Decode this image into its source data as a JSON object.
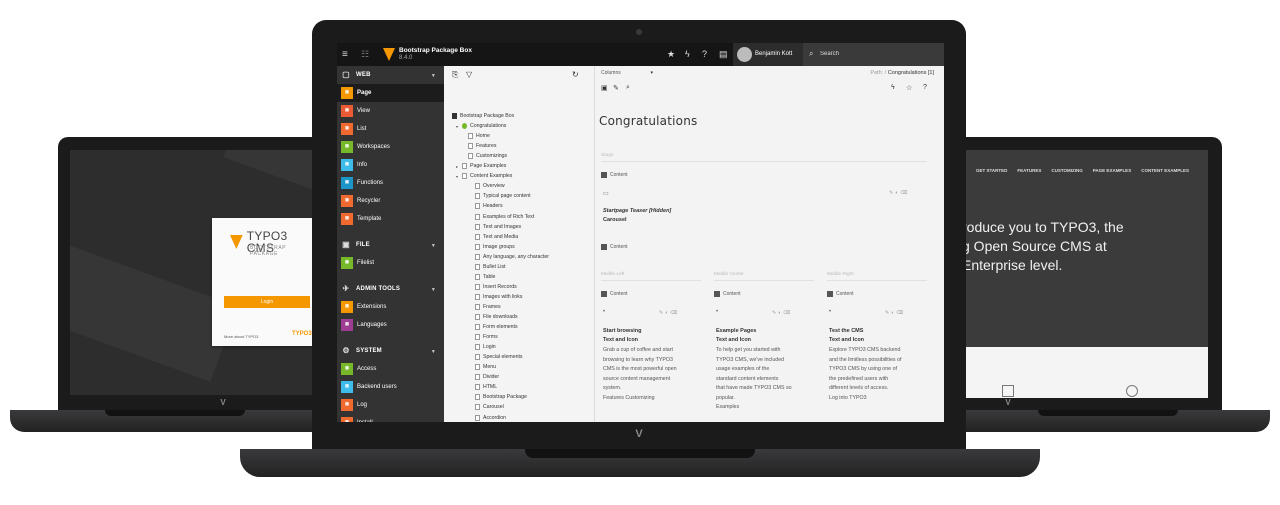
{
  "left_laptop": {
    "login": {
      "brand": "TYPO3 CMS",
      "subtitle": "BOOTSTRAP PACKAGE",
      "button_label": "Login",
      "footer_text": "More about TYPO3",
      "footer_mark": "TYPO3"
    }
  },
  "right_laptop": {
    "nav": [
      "GET STARTED",
      "FEATURES",
      "CUSTOMIZING",
      "PAGE EXAMPLES",
      "CONTENT EXAMPLES"
    ],
    "hero_lines": [
      "roduce you to TYPO3, the",
      "g Open Source CMS at",
      "Enterprise level."
    ]
  },
  "center_laptop": {
    "topbar": {
      "site_name": "Bootstrap Package Box",
      "site_version": "8.4.0",
      "user_name": "Benjamin Kott",
      "search_placeholder": "Search"
    },
    "module_menu": [
      {
        "type": "group",
        "label": "WEB",
        "icon": "web-icon"
      },
      {
        "type": "item",
        "label": "Page",
        "icon": "page-icon",
        "color": "#f49700",
        "active": true
      },
      {
        "type": "item",
        "label": "View",
        "icon": "view-icon",
        "color": "#ea5a34"
      },
      {
        "type": "item",
        "label": "List",
        "icon": "list-icon",
        "color": "#f06a2f"
      },
      {
        "type": "item",
        "label": "Workspaces",
        "icon": "workspaces-icon",
        "color": "#76b82a"
      },
      {
        "type": "item",
        "label": "Info",
        "icon": "info-icon",
        "color": "#3dbbe9"
      },
      {
        "type": "item",
        "label": "Functions",
        "icon": "functions-icon",
        "color": "#1c95c8"
      },
      {
        "type": "item",
        "label": "Recycler",
        "icon": "recycler-icon",
        "color": "#f06a2f"
      },
      {
        "type": "item",
        "label": "Template",
        "icon": "template-icon",
        "color": "#f06a2f"
      },
      {
        "type": "group",
        "label": "FILE",
        "icon": "file-icon"
      },
      {
        "type": "item",
        "label": "Filelist",
        "icon": "filelist-icon",
        "color": "#76b82a"
      },
      {
        "type": "group",
        "label": "ADMIN TOOLS",
        "icon": "admin-tools-icon"
      },
      {
        "type": "item",
        "label": "Extensions",
        "icon": "extensions-icon",
        "color": "#f49700"
      },
      {
        "type": "item",
        "label": "Languages",
        "icon": "languages-icon",
        "color": "#9e3d93"
      },
      {
        "type": "group",
        "label": "SYSTEM",
        "icon": "system-icon"
      },
      {
        "type": "item",
        "label": "Access",
        "icon": "access-icon",
        "color": "#76b82a"
      },
      {
        "type": "item",
        "label": "Backend users",
        "icon": "backend-users-icon",
        "color": "#3dbbe9"
      },
      {
        "type": "item",
        "label": "Log",
        "icon": "log-icon",
        "color": "#f06a2f"
      },
      {
        "type": "item",
        "label": "Install",
        "icon": "install-icon",
        "color": "#f06a2f"
      }
    ],
    "tree": [
      {
        "label": "Bootstrap Package Box",
        "indent": 0,
        "root": true
      },
      {
        "label": "Congratulations",
        "indent": 1,
        "toggle": "▾",
        "home": true
      },
      {
        "label": "Home",
        "indent": 2
      },
      {
        "label": "Features",
        "indent": 2
      },
      {
        "label": "Customizings",
        "indent": 2
      },
      {
        "label": "Page Examples",
        "indent": 1,
        "toggle": "▸"
      },
      {
        "label": "Content Examples",
        "indent": 1,
        "toggle": "▾"
      },
      {
        "label": "Overview",
        "indent": 3
      },
      {
        "label": "Typical page content",
        "indent": 3
      },
      {
        "label": "Headers",
        "indent": 3
      },
      {
        "label": "Examples of Rich Text",
        "indent": 3
      },
      {
        "label": "Text and Images",
        "indent": 3
      },
      {
        "label": "Text and Media",
        "indent": 3
      },
      {
        "label": "Image groups",
        "indent": 3
      },
      {
        "label": "Any language, any character",
        "indent": 3
      },
      {
        "label": "Bullet List",
        "indent": 3
      },
      {
        "label": "Table",
        "indent": 3
      },
      {
        "label": "Insert Records",
        "indent": 3
      },
      {
        "label": "Images with links",
        "indent": 3
      },
      {
        "label": "Frames",
        "indent": 3
      },
      {
        "label": "File downloads",
        "indent": 3
      },
      {
        "label": "Form elements",
        "indent": 3
      },
      {
        "label": "Forms",
        "indent": 3
      },
      {
        "label": "Login",
        "indent": 3
      },
      {
        "label": "Special elements",
        "indent": 3
      },
      {
        "label": "Menu",
        "indent": 3
      },
      {
        "label": "Divider",
        "indent": 3
      },
      {
        "label": "HTML",
        "indent": 3
      },
      {
        "label": "Bootstrap Package",
        "indent": 3
      },
      {
        "label": "Carousel",
        "indent": 3
      },
      {
        "label": "Accordion",
        "indent": 3
      }
    ],
    "content": {
      "view_select": "Columns",
      "path_label": "Path: /",
      "path_page": "Congratulations [1]",
      "page_title": "Congratulations",
      "stage_label": "Stage",
      "top_content_label": "Content",
      "teaser_title": "Startpage Teaser [Hidden]",
      "teaser_sub": "Carousel",
      "second_content_label": "Content",
      "columns": [
        {
          "label": "Middle Left",
          "content_label": "Content",
          "title": "Start browsing",
          "subtitle": "Text and Icon",
          "lines": [
            "Grab a cup of coffee and start",
            "browsing to learn why TYPO3",
            "CMS is the most powerful open",
            "source content management",
            "system.",
            "Features Customizing"
          ]
        },
        {
          "label": "Middle Center",
          "content_label": "Content",
          "title": "Example Pages",
          "subtitle": "Text and Icon",
          "lines": [
            "To help get you started with",
            "TYPO3 CMS, we've included",
            "usage examples of the",
            "standard content elements",
            "that have made TYPO3 CMS so",
            "popular.",
            "Examples"
          ]
        },
        {
          "label": "Middle Right",
          "content_label": "Content",
          "title": "Test the CMS",
          "subtitle": "Text and Icon",
          "lines": [
            "Explore TYPO3 CMS backend",
            "and the limitless possibilities of",
            "TYPO3 CMS by using one of",
            "the predefined users with",
            "different levels of access.",
            "Log into TYPO3"
          ]
        }
      ]
    }
  }
}
